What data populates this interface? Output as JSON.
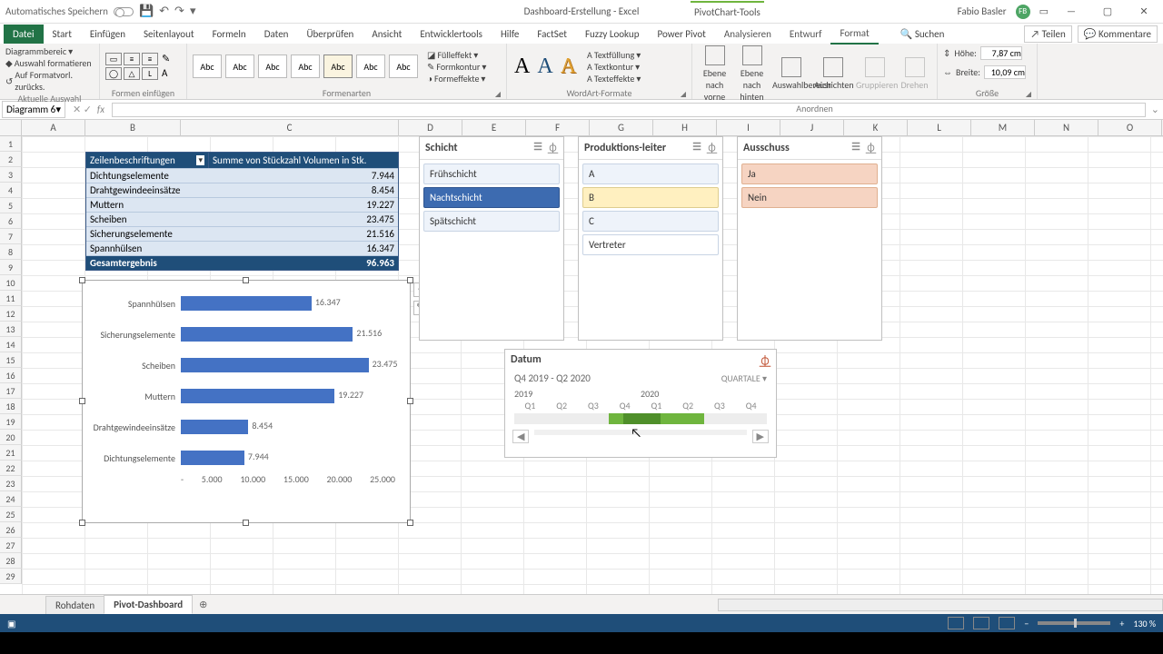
{
  "title": {
    "autosave": "Automatisches Speichern",
    "docname": "Dashboard-Erstellung - Excel",
    "tool": "PivotChart-Tools",
    "user": "Fabio Basler"
  },
  "ribbon_tabs": [
    "Datei",
    "Start",
    "Einfügen",
    "Seitenlayout",
    "Formeln",
    "Daten",
    "Überprüfen",
    "Ansicht",
    "Entwicklertools",
    "Hilfe",
    "FactSet",
    "Fuzzy Lookup",
    "Power Pivot",
    "Analysieren",
    "Entwurf",
    "Format",
    "Suchen"
  ],
  "ribbon_right": {
    "share": "Teilen",
    "comments": "Kommentare"
  },
  "ribbon_groups": {
    "g1": [
      "Diagrammbereic",
      "Auswahl formatieren",
      "Auf Formatvorl. zurücks."
    ],
    "g2_label": "Formen einfügen",
    "g3_label": "Formenarten",
    "g3_items": [
      "Fülleffekt",
      "Formkontur",
      "Formeffekte"
    ],
    "g4_label": "WordArt-Formate",
    "g4_items": [
      "Textfüllung",
      "Textkontur",
      "Texteffekte"
    ],
    "g5": [
      "Ebene nach vorne",
      "Ebene nach hinten",
      "Auswahlbereich",
      "Ausrichten",
      "Gruppieren",
      "Drehen"
    ],
    "g5_label": "Anordnen",
    "g6": {
      "h": "Höhe:",
      "w": "Breite:",
      "hv": "7,87 cm",
      "wv": "10,09 cm",
      "label": "Größe"
    }
  },
  "group_labels": {
    "g1": "Aktuelle Auswahl"
  },
  "namebox": "Diagramm 6",
  "pivot": {
    "head1": "Zeilenbeschriftungen",
    "head2": "Summe von Stückzahl Volumen in Stk.",
    "rows": [
      {
        "l": "Dichtungselemente",
        "v": "7.944"
      },
      {
        "l": "Drahtgewindeeinsätze",
        "v": "8.454"
      },
      {
        "l": "Muttern",
        "v": "19.227"
      },
      {
        "l": "Scheiben",
        "v": "23.475"
      },
      {
        "l": "Sicherungselemente",
        "v": "21.516"
      },
      {
        "l": "Spannhülsen",
        "v": "16.347"
      }
    ],
    "total_l": "Gesamtergebnis",
    "total_v": "96.963"
  },
  "chart_data": {
    "type": "bar",
    "categories": [
      "Spannhülsen",
      "Sicherungselemente",
      "Scheiben",
      "Muttern",
      "Drahtgewindeeinsätze",
      "Dichtungselemente"
    ],
    "values": [
      16347,
      21516,
      23475,
      19227,
      8454,
      7944
    ],
    "labels": [
      "16.347",
      "21.516",
      "23.475",
      "19.227",
      "8.454",
      "7.944"
    ],
    "xticks": [
      "-",
      "5.000",
      "10.000",
      "15.000",
      "20.000",
      "25.000"
    ],
    "xlim": [
      0,
      25000
    ]
  },
  "slicers": {
    "schicht": {
      "title": "Schicht",
      "items": [
        "Frühschicht",
        "Nachtschicht",
        "Spätschicht"
      ]
    },
    "prod": {
      "title": "Produktions-leiter",
      "items": [
        "A",
        "B",
        "C",
        "Vertreter"
      ]
    },
    "aus": {
      "title": "Ausschuss",
      "items": [
        "Ja",
        "Nein"
      ]
    }
  },
  "timeline": {
    "title": "Datum",
    "range": "Q4 2019 - Q2 2020",
    "level": "QUARTALE",
    "years": [
      "2019",
      "2020"
    ],
    "quarters": [
      "Q1",
      "Q2",
      "Q3",
      "Q4",
      "Q1",
      "Q2",
      "Q3",
      "Q4"
    ]
  },
  "sheets": {
    "tabs": [
      "Rohdaten",
      "Pivot-Dashboard"
    ]
  },
  "zoom": "130 %"
}
